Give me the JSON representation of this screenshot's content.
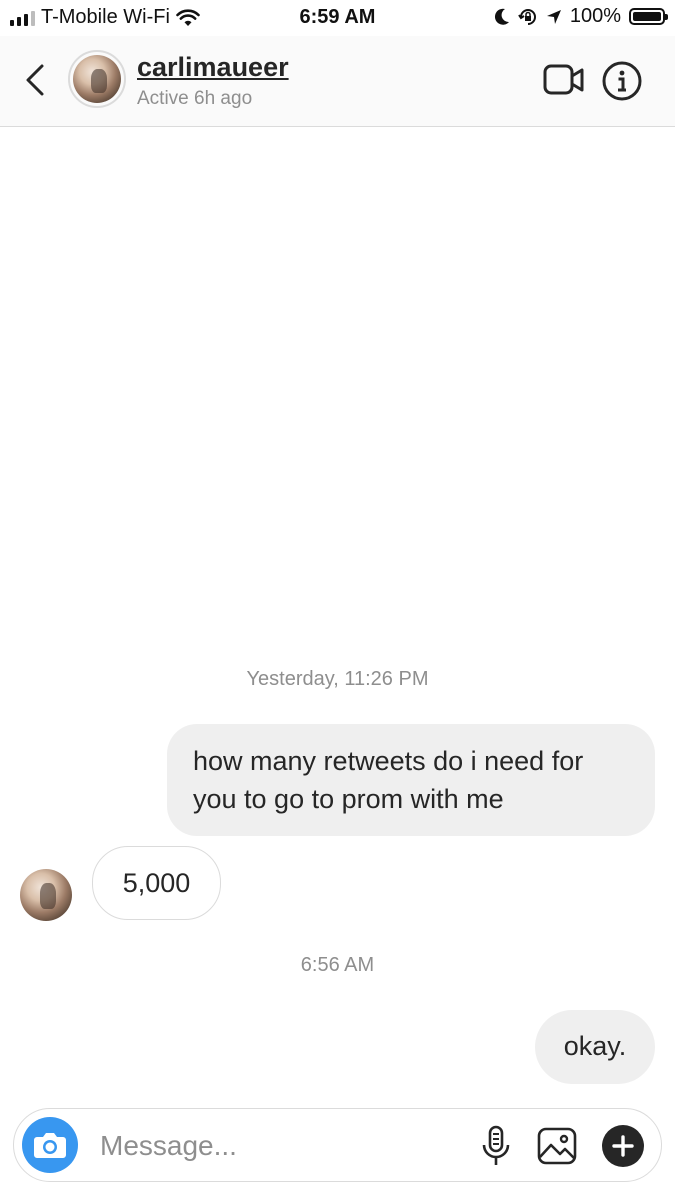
{
  "status_bar": {
    "carrier": "T-Mobile Wi-Fi",
    "time": "6:59 AM",
    "battery": "100%"
  },
  "header": {
    "username": "carlimaueer",
    "active_status": "Active 6h ago"
  },
  "thread": {
    "timestamp_1": "Yesterday, 11:26 PM",
    "message_1": "how many retweets do i need for you to go to prom with me",
    "message_2": "5,000",
    "timestamp_2": "6:56 AM",
    "message_3": "okay."
  },
  "composer": {
    "placeholder": "Message..."
  },
  "colors": {
    "accent": "#3897f0",
    "sent_bubble": "#efefef",
    "muted_text": "#8e8e8e"
  },
  "icons": [
    "signal-icon",
    "wifi-icon",
    "moon-icon",
    "orientation-lock-icon",
    "location-arrow-icon",
    "battery-icon",
    "back-chevron-icon",
    "video-call-icon",
    "info-icon",
    "camera-icon",
    "microphone-icon",
    "gallery-icon",
    "plus-icon"
  ]
}
